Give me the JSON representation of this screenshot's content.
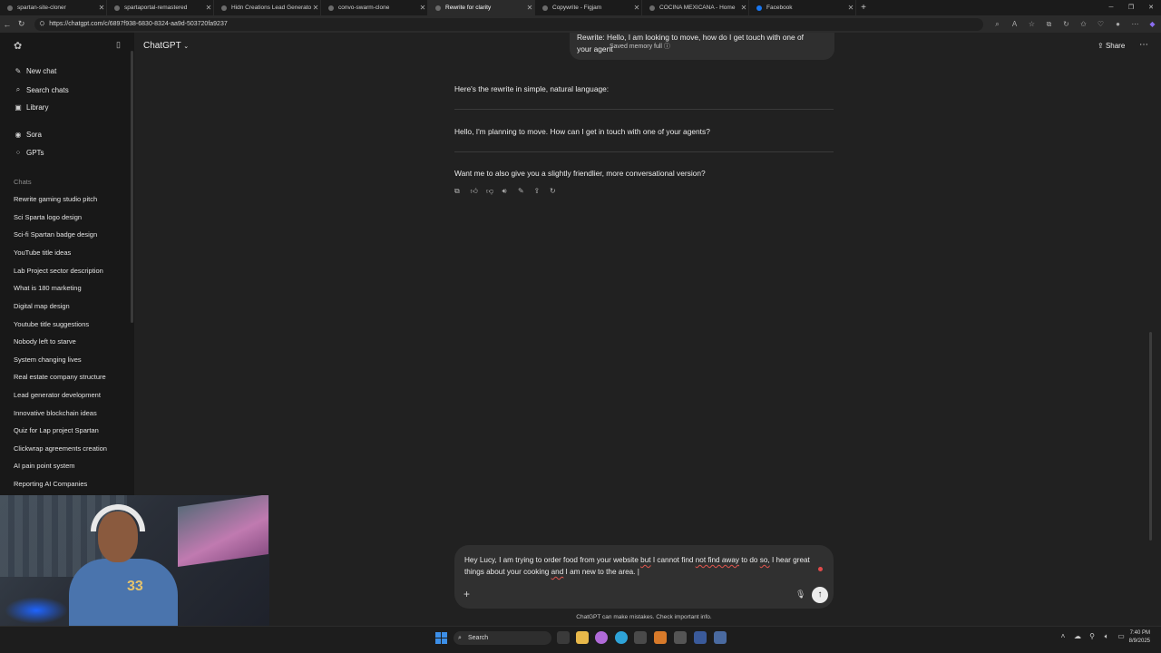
{
  "browser": {
    "tabs": [
      {
        "label": "spartan-site-cloner",
        "active": false
      },
      {
        "label": "spartaportal-remastered",
        "active": false
      },
      {
        "label": "Hidn Creations Lead Generator -",
        "active": false
      },
      {
        "label": "convo-swarm-clone",
        "active": false
      },
      {
        "label": "Rewrite for clarity",
        "active": true
      },
      {
        "label": "Copywrite - Figjam",
        "active": false
      },
      {
        "label": "COCINA MEXICANA - Home",
        "active": false
      },
      {
        "label": "Facebook",
        "active": false
      }
    ],
    "new_tab": "+",
    "url": "https://chatgpt.com/c/6897f938-6830-8324-aa9d-503720fa9237"
  },
  "sidebar": {
    "new_chat": "New chat",
    "search_chats": "Search chats",
    "library": "Library",
    "sora": "Sora",
    "gpts": "GPTs",
    "chats_heading": "Chats",
    "chats": [
      "Rewrite gaming studio pitch",
      "Sci Sparta logo design",
      "Sci-fi Spartan badge design",
      "YouTube title ideas",
      "Lab Project sector description",
      "What is 180 marketing",
      "Digital map design",
      "Youtube title suggestions",
      "Nobody left to starve",
      "System changing lives",
      "Real estate company structure",
      "Lead generator development",
      "Innovative blockchain ideas",
      "Quiz for Lap project Spartan",
      "Clickwrap agreements creation",
      "AI pain point system",
      "Reporting AI Companies"
    ]
  },
  "header": {
    "model": "ChatGPT",
    "share": "Share"
  },
  "conversation": {
    "user_message_line1": "Rewrite: Hello, I am looking to move, how do I get touch with one of",
    "user_message_line2": "your agent",
    "memory_badge": "Saved memory full",
    "assistant_intro": "Here's the rewrite in simple, natural language:",
    "assistant_rewrite": "Hello, I'm planning to move. How can I get in touch with one of your agents?",
    "assistant_followup": "Want me to also give you a slightly friendlier, more conversational version?"
  },
  "composer": {
    "text_parts": [
      {
        "text": "Hey Lucy,  I am trying to order food from your website ",
        "spell": false
      },
      {
        "text": "but",
        "spell": true
      },
      {
        "text": " I cannot find ",
        "spell": false
      },
      {
        "text": "not find away",
        "spell": true
      },
      {
        "text": " to do ",
        "spell": false
      },
      {
        "text": "so,",
        "spell": true
      },
      {
        "text": " I hear great things about your cooking ",
        "spell": false
      },
      {
        "text": "and",
        "spell": true
      },
      {
        "text": " I am new to the area. |",
        "spell": false
      }
    ],
    "disclaimer": "ChatGPT can make mistakes. Check important info."
  },
  "taskbar": {
    "search": "Search",
    "time": "7:40 PM",
    "date": "8/9/2025"
  },
  "icons": {
    "accent_blue": "#3c8fe8",
    "spell_red": "#e0554e"
  }
}
